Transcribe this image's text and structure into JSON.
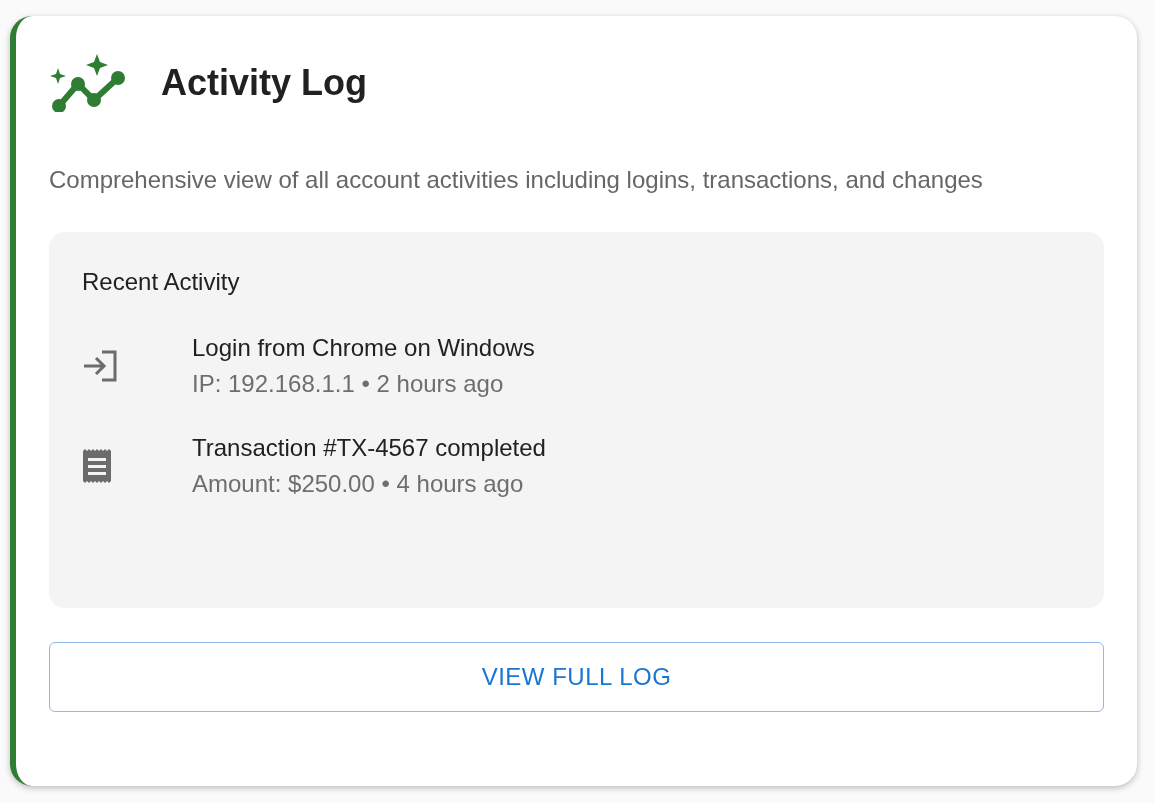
{
  "card": {
    "title": "Activity Log",
    "description": "Comprehensive view of all account activities including logins, transactions, and changes"
  },
  "recent": {
    "heading": "Recent Activity",
    "items": [
      {
        "kind": "login",
        "title": "Login from Chrome on Windows",
        "detail": "IP: 192.168.1.1 • 2 hours ago"
      },
      {
        "kind": "transaction",
        "title": "Transaction #TX-4567 completed",
        "detail": "Amount: $250.00 • 4 hours ago"
      }
    ]
  },
  "button": {
    "label": "VIEW FULL LOG"
  }
}
